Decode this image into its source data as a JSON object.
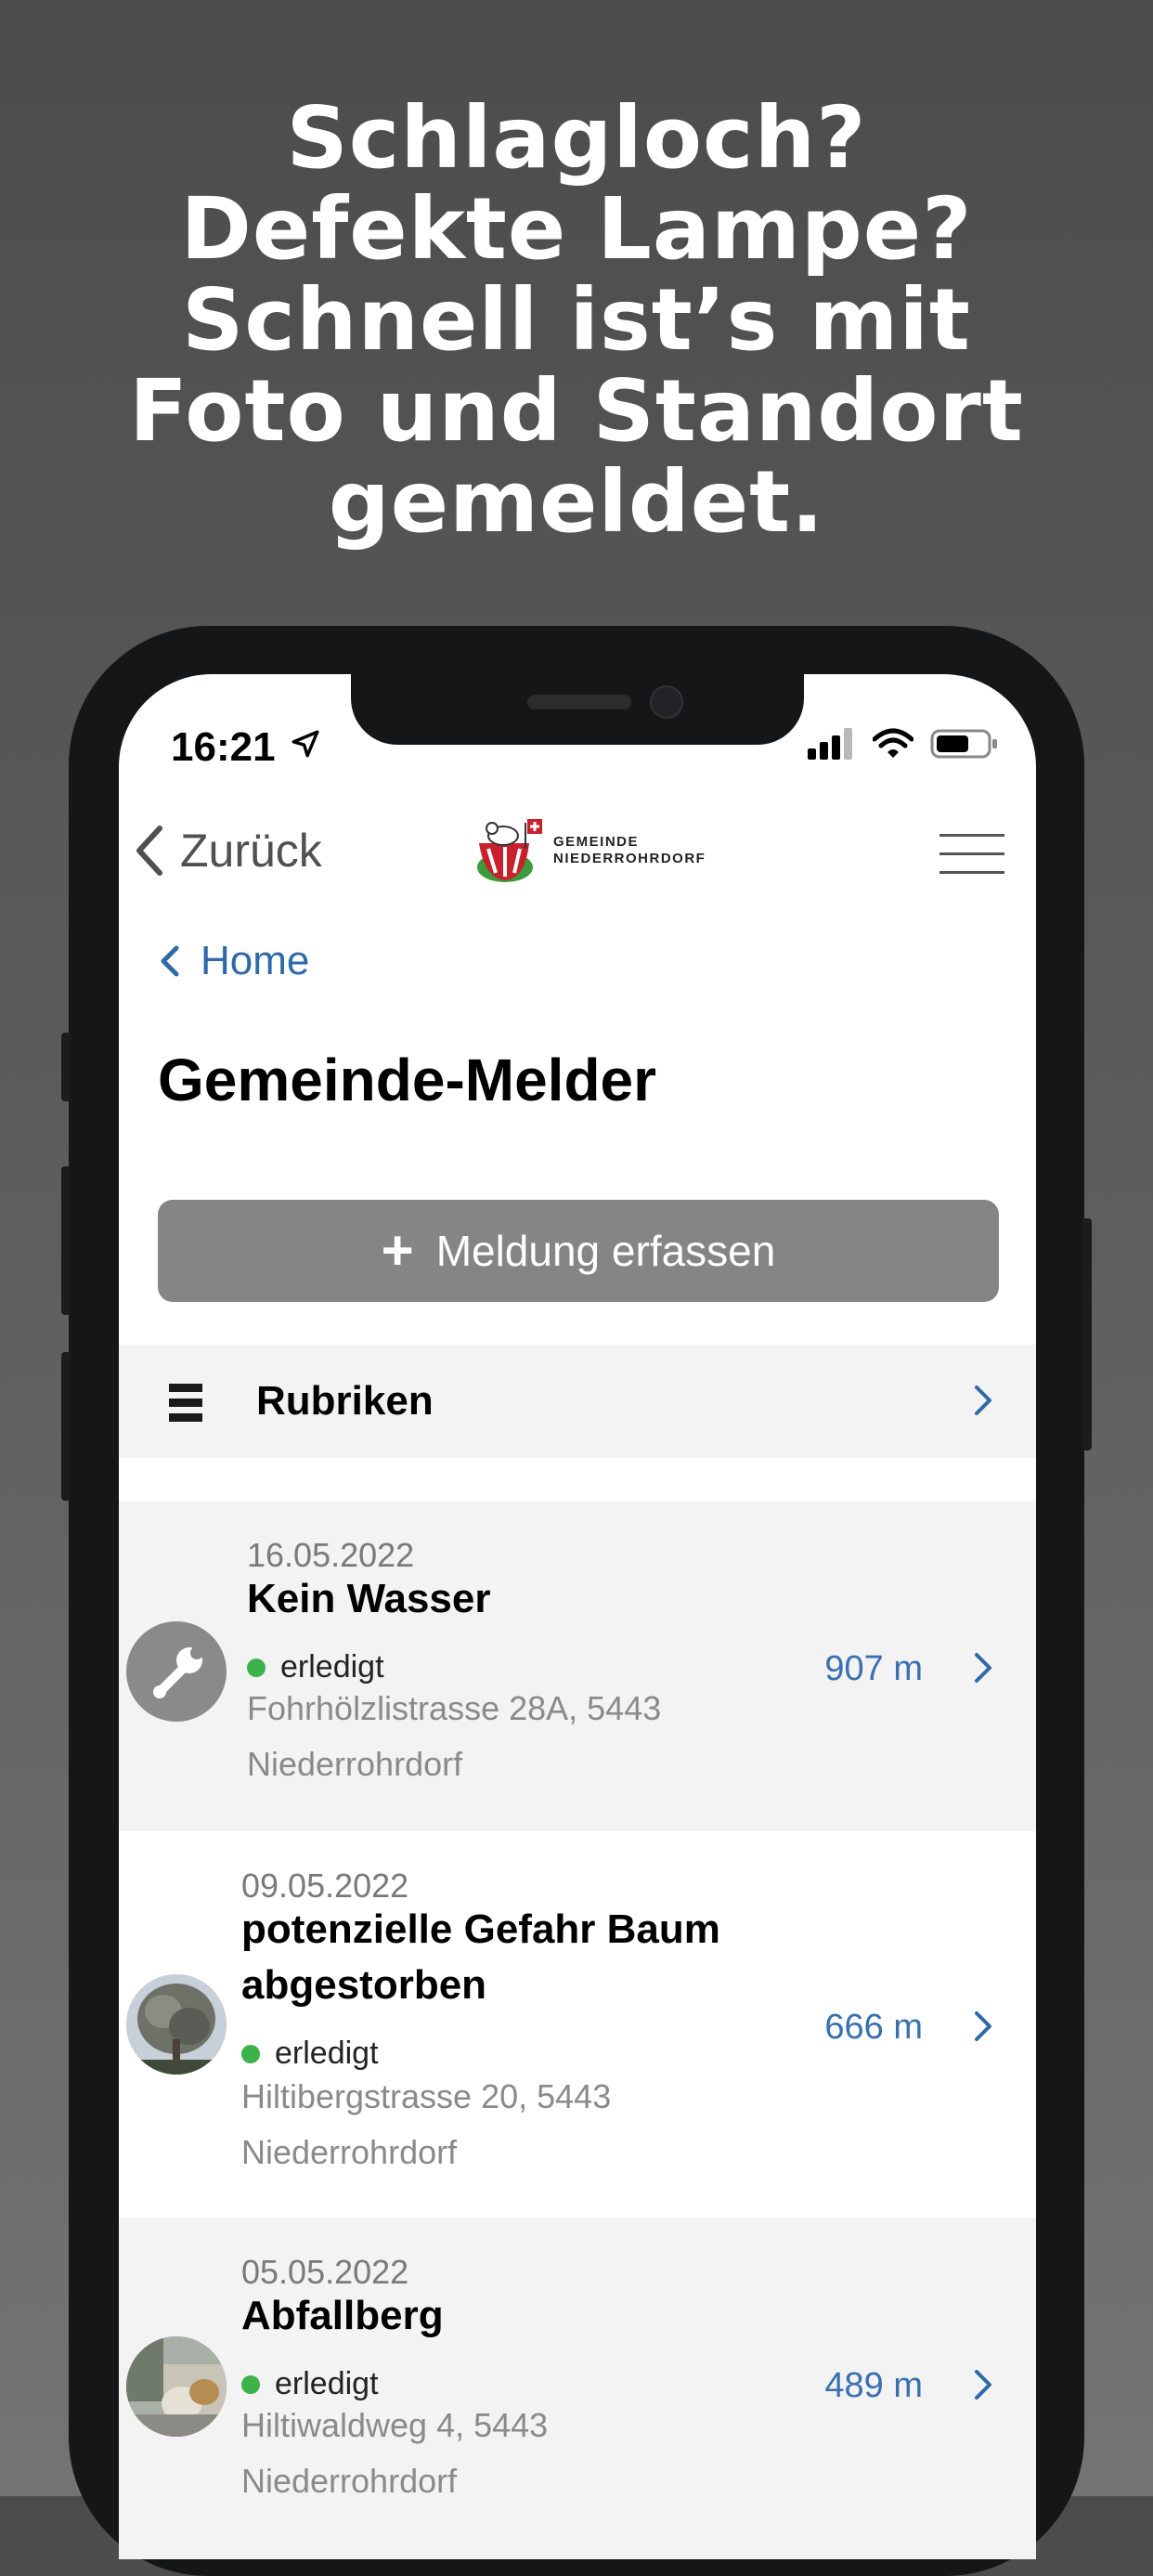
{
  "headline": {
    "lines": [
      "Schlagloch?",
      "Defekte Lampe?",
      "Schnell ist’s mit",
      "Foto und Standort",
      "gemeldet."
    ]
  },
  "status_bar": {
    "time": "16:21"
  },
  "nav": {
    "back_label": "Zurück",
    "logo_line1": "GEMEINDE",
    "logo_line2": "NIEDERROHRDORF"
  },
  "breadcrumb": {
    "label": "Home"
  },
  "page": {
    "title": "Gemeinde-Melder"
  },
  "add_button": {
    "icon": "+",
    "label": "Meldung erfassen"
  },
  "categories": {
    "label": "Rubriken"
  },
  "reports": [
    {
      "date": "16.05.2022",
      "title": "Kein Wasser",
      "status": "erledigt",
      "address_line1": "Fohrhölzlistrasse 28A, 5443",
      "address_line2": "Niederrohrdorf",
      "distance": "907 m",
      "thumb_icon": "wrench-icon"
    },
    {
      "date": "09.05.2022",
      "title_line1": "potenzielle Gefahr Baum",
      "title_line2": "abgestorben",
      "status": "erledigt",
      "address_line1": "Hiltibergstrasse 20, 5443",
      "address_line2": "Niederrohrdorf",
      "distance": "666 m",
      "thumb_icon": "tree-photo"
    },
    {
      "date": "05.05.2022",
      "title": "Abfallberg",
      "status": "erledigt",
      "address_line1": "Hiltiwaldweg 4, 5443",
      "address_line2": "Niederrohrdorf",
      "distance": "489 m",
      "thumb_icon": "waste-photo"
    }
  ],
  "colors": {
    "accent_blue": "#2e6aa8",
    "status_green": "#3bb34a",
    "button_gray": "#858585"
  }
}
